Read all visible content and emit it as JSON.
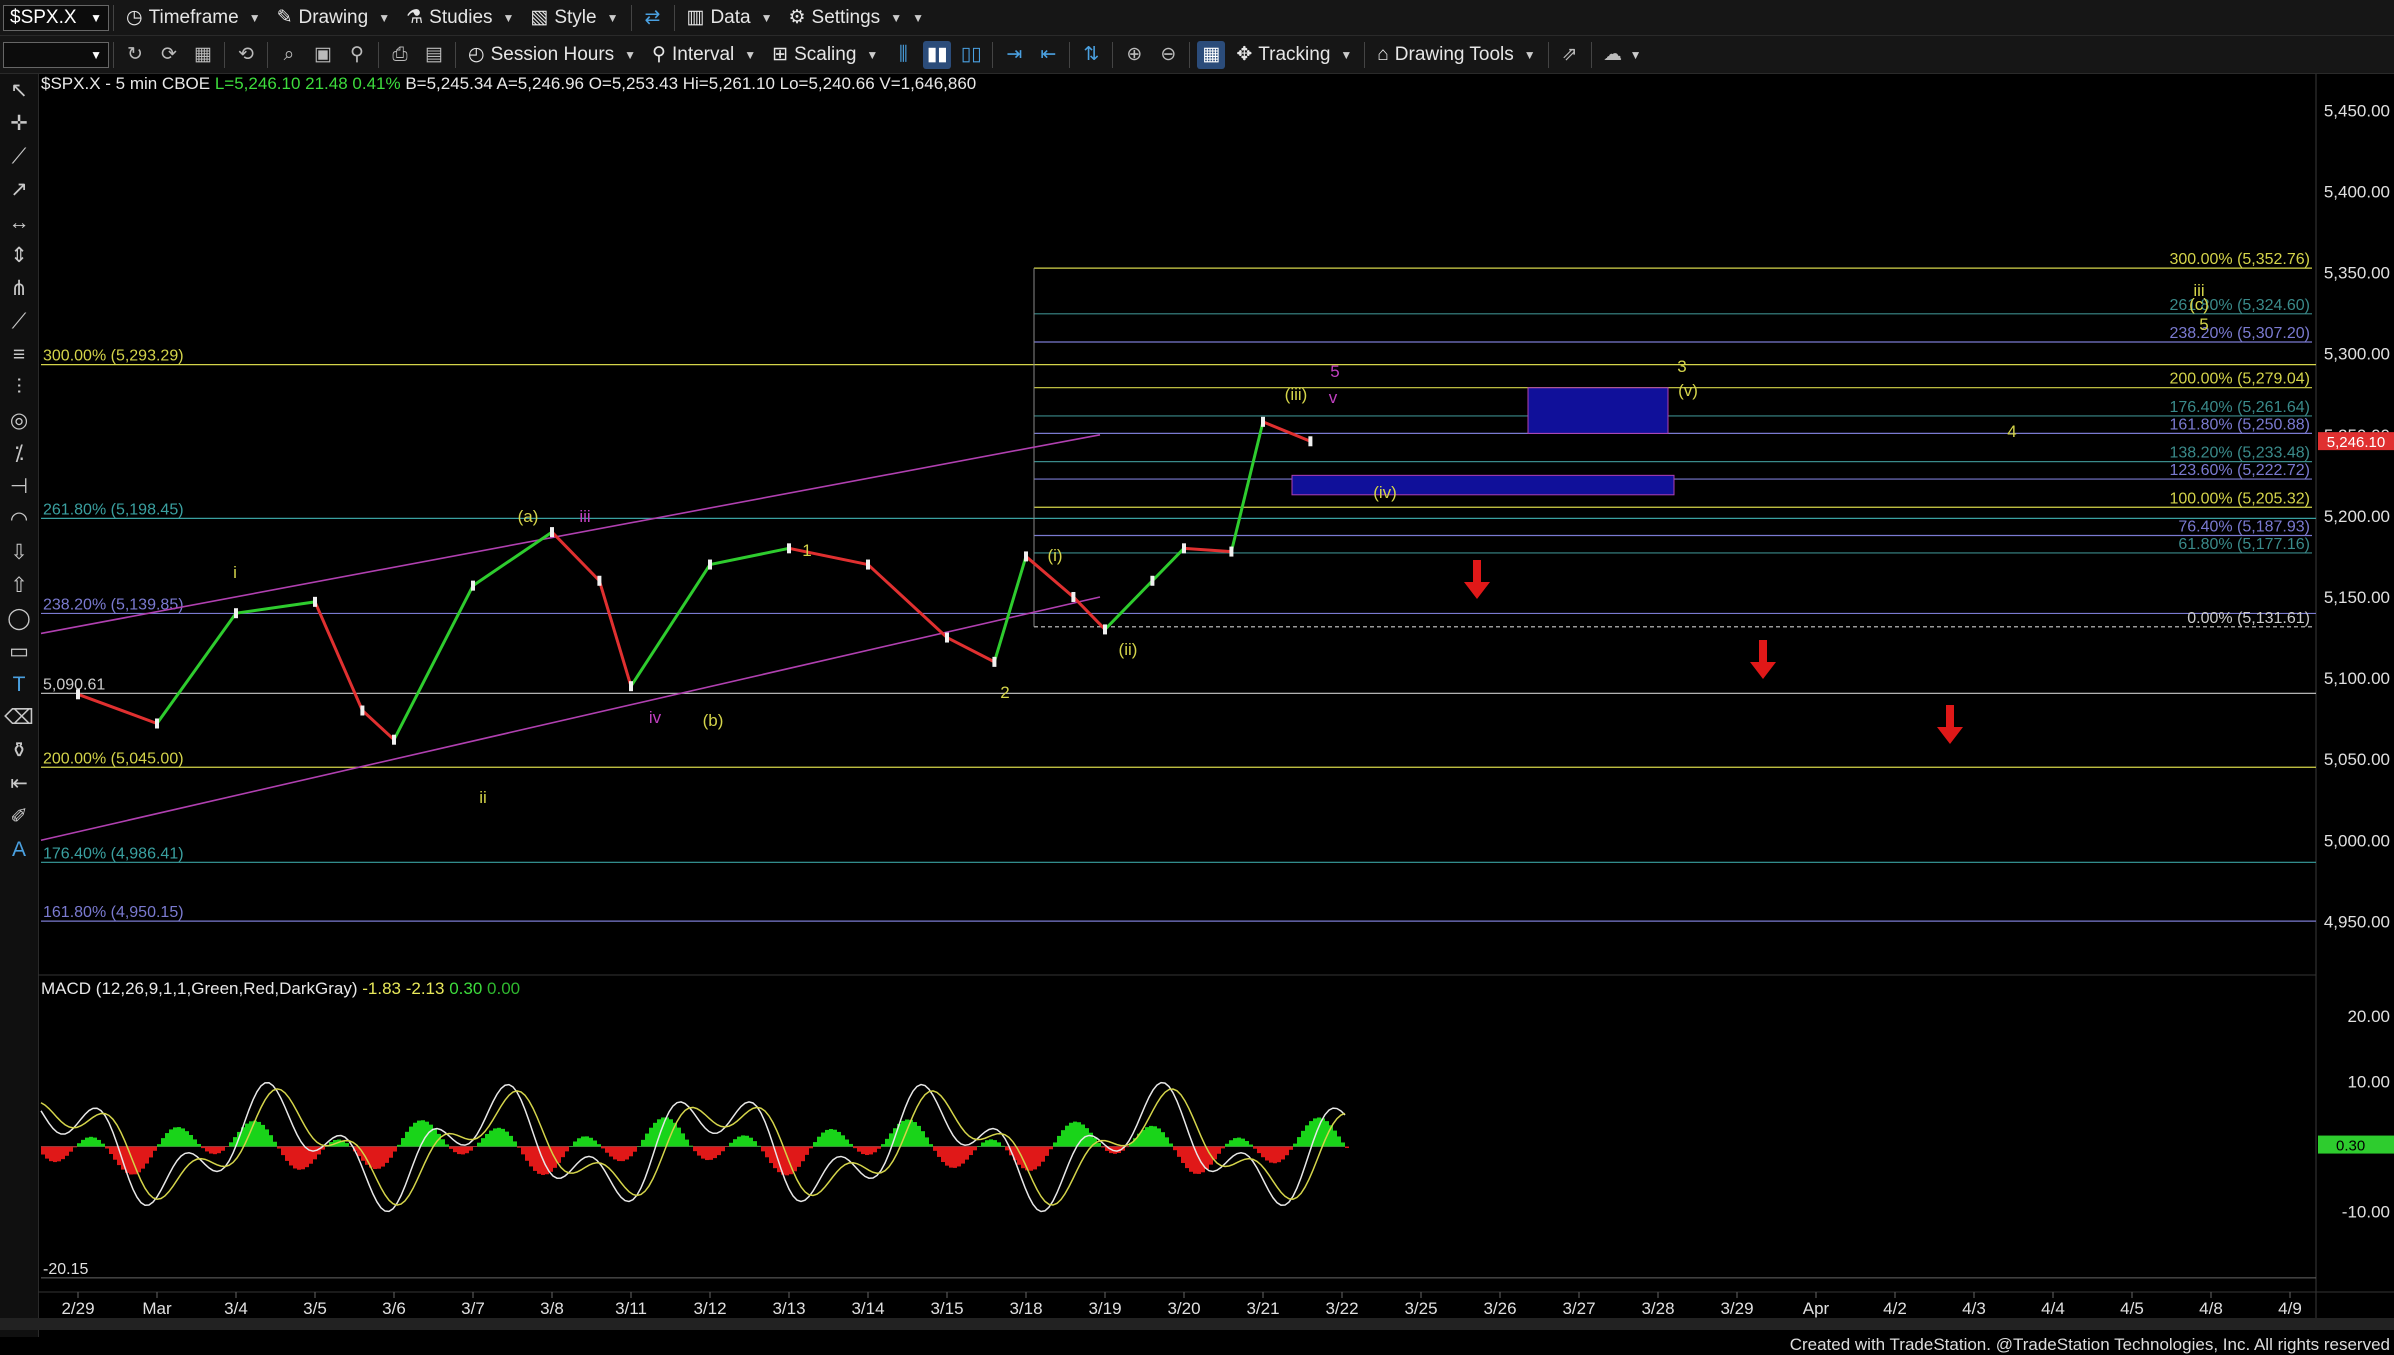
{
  "toolbar1": {
    "symbol": "$SPX.X",
    "timeframe": "Timeframe",
    "drawing": "Drawing",
    "studies": "Studies",
    "style": "Style",
    "data": "Data",
    "settings": "Settings"
  },
  "toolbar2": {
    "session": "Session Hours",
    "interval": "Interval",
    "scaling": "Scaling",
    "tracking": "Tracking",
    "drawing_tools": "Drawing Tools"
  },
  "header": {
    "title": "$SPX.X - 5 min  CBOE ",
    "last": "L=5,246.10  21.48  0.41%",
    "rest": "  B=5,245.34  A=5,246.96  O=5,253.43  Hi=5,261.10  Lo=5,240.66  V=1,646,860"
  },
  "macd_header": {
    "label": "MACD (12,26,9,1,1,Green,Red,DarkGray) ",
    "v1": "-1.83",
    "v2": "-2.13",
    "v3": "0.30",
    "v4": "0.00"
  },
  "footer": "Created with TradeStation. @TradeStation Technologies, Inc. All rights reserved",
  "colors": {
    "background": "#000000",
    "up": "#2ecc2e",
    "down": "#e03030",
    "yellow": "#d4d44a",
    "magenta": "#c040c0",
    "blue": "#1010a0"
  },
  "chart_data": {
    "type": "line",
    "interval": "5 min",
    "ylim": [
      4920,
      5470
    ],
    "y_ticks": [
      "5,450.00",
      "5,400.00",
      "5,350.00",
      "5,300.00",
      "5,250.00",
      "5,200.00",
      "5,150.00",
      "5,100.00",
      "5,050.00",
      "5,000.00",
      "4,950.00"
    ],
    "x_ticks": [
      "2/29",
      "Mar",
      "3/4",
      "3/5",
      "3/6",
      "3/7",
      "3/8",
      "3/11",
      "3/12",
      "3/13",
      "3/14",
      "3/15",
      "3/18",
      "3/19",
      "3/20",
      "3/21",
      "3/22",
      "3/25",
      "3/26",
      "3/27",
      "3/28",
      "3/29",
      "Apr",
      "4/2",
      "4/3",
      "4/4",
      "4/5",
      "4/8",
      "4/9"
    ],
    "last_price": "5,246.10",
    "series": [
      {
        "name": "$SPX.X",
        "x": [
          "2/29",
          "3/1",
          "3/4",
          "3/5",
          "3/5",
          "3/6",
          "3/7",
          "3/8",
          "3/8",
          "3/11",
          "3/12",
          "3/13",
          "3/14",
          "3/15",
          "3/15",
          "3/18",
          "3/18",
          "3/19",
          "3/19",
          "3/20",
          "3/20",
          "3/21",
          "3/21"
        ],
        "values": [
          5090,
          5072,
          5140,
          5147,
          5080,
          5062,
          5157,
          5190,
          5160,
          5095,
          5170,
          5180,
          5170,
          5125,
          5110,
          5175,
          5150,
          5130,
          5160,
          5180,
          5178,
          5258,
          5246
        ]
      }
    ],
    "left_fib_levels": [
      {
        "label": "300.00% (5,293.29)",
        "value": 5293.29
      },
      {
        "label": "261.80% (5,198.45)",
        "value": 5198.45
      },
      {
        "label": "238.20% (5,139.85)",
        "value": 5139.85
      },
      {
        "label": "5,090.61",
        "value": 5090.61
      },
      {
        "label": "200.00% (5,045.00)",
        "value": 5045.0
      },
      {
        "label": "176.40% (4,986.41)",
        "value": 4986.41
      },
      {
        "label": "161.80% (4,950.15)",
        "value": 4950.15
      }
    ],
    "right_fib_levels": [
      {
        "label": "300.00% (5,352.76)",
        "value": 5352.76
      },
      {
        "label": "261.80% (5,324.60)",
        "value": 5324.6
      },
      {
        "label": "238.20% (5,307.20)",
        "value": 5307.2
      },
      {
        "label": "200.00% (5,279.04)",
        "value": 5279.04
      },
      {
        "label": "176.40% (5,261.64)",
        "value": 5261.64
      },
      {
        "label": "161.80% (5,250.88)",
        "value": 5250.88
      },
      {
        "label": "138.20% (5,233.48)",
        "value": 5233.48
      },
      {
        "label": "123.60% (5,222.72)",
        "value": 5222.72
      },
      {
        "label": "100.00% (5,205.32)",
        "value": 5205.32
      },
      {
        "label": "76.40% (5,187.93)",
        "value": 5187.93
      },
      {
        "label": "61.80% (5,177.16)",
        "value": 5177.16
      },
      {
        "label": "0.00% (5,131.61)",
        "value": 5131.61
      }
    ],
    "wave_labels": [
      "i",
      "ii",
      "iii",
      "iv",
      "(a)",
      "(b)",
      "1",
      "2",
      "(i)",
      "(ii)",
      "(iii)",
      "(iv)",
      "(v)",
      "v",
      "5",
      "3",
      "4",
      "iii",
      "(c)",
      "5"
    ],
    "macd": {
      "y_ticks": [
        "20.00",
        "10.00",
        "0.30",
        "-10.00",
        "-20.15"
      ],
      "ylim": [
        -22,
        24
      ],
      "values": [
        -1.83,
        -2.13,
        0.3,
        0.0
      ]
    }
  }
}
